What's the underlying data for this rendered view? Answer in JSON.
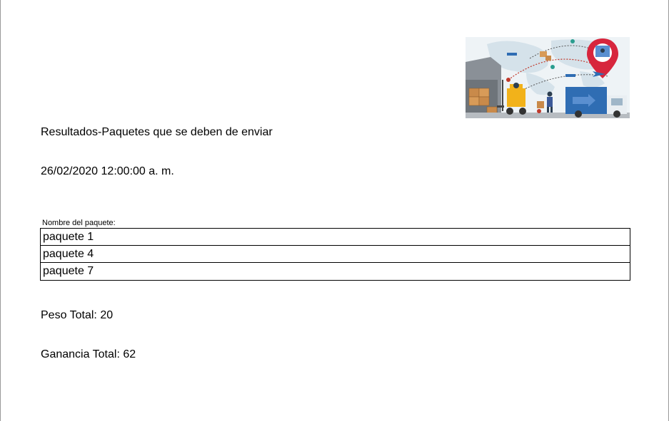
{
  "report": {
    "title": "Resultados-Paquetes que se deben de enviar",
    "date": "26/02/2020 12:00:00 a. m.",
    "table_caption": "Nombre del paquete:",
    "packages": [
      "paquete 1",
      "paquete 4",
      "paquete 7"
    ],
    "total_weight": "Peso Total: 20",
    "total_profit": "Ganancia Total: 62"
  },
  "image": {
    "icon": "logistics-illustration",
    "colors": {
      "map": "#d9e6ee",
      "warehouse": "#8a9097",
      "truck": "#2f6db3",
      "forklift": "#f2b21a",
      "pin": "#d7263d",
      "boxes": "#c98a4a"
    }
  }
}
